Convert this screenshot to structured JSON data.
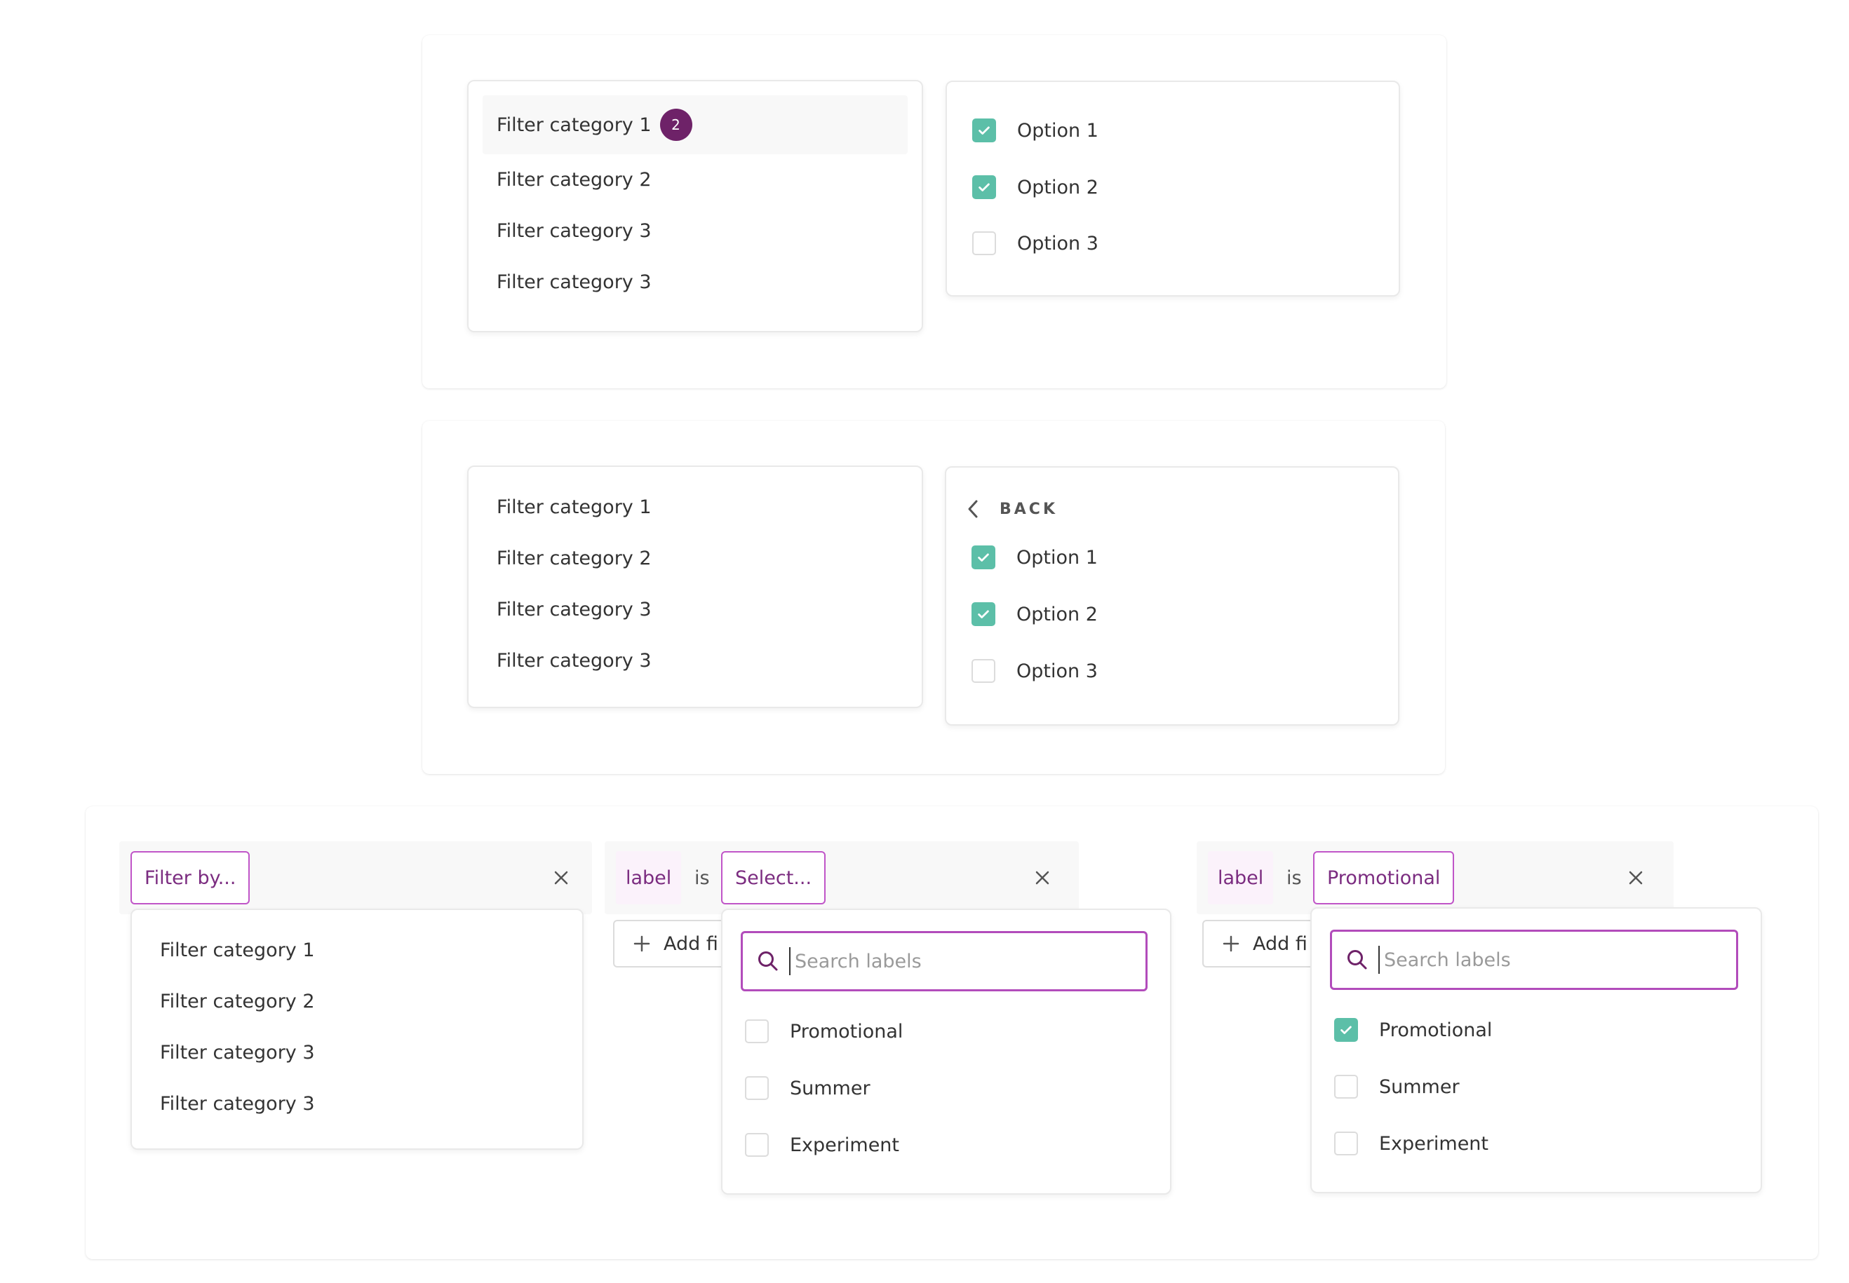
{
  "panel1": {
    "categories": [
      {
        "label": "Filter category 1",
        "badge": "2"
      },
      {
        "label": "Filter category 2"
      },
      {
        "label": "Filter category 3"
      },
      {
        "label": "Filter category 3"
      }
    ],
    "options": [
      {
        "label": "Option 1",
        "checked": true
      },
      {
        "label": "Option 2",
        "checked": true
      },
      {
        "label": "Option 3",
        "checked": false
      }
    ]
  },
  "panel2": {
    "categories": [
      "Filter category 1",
      "Filter category 2",
      "Filter category 3",
      "Filter category 3"
    ],
    "back_label": "BACK",
    "options": [
      {
        "label": "Option 1",
        "checked": true
      },
      {
        "label": "Option 2",
        "checked": true
      },
      {
        "label": "Option 3",
        "checked": false
      }
    ]
  },
  "panel3": {
    "filter1": {
      "pill": "Filter by...",
      "menu": [
        "Filter category 1",
        "Filter category 2",
        "Filter category 3",
        "Filter category 3"
      ]
    },
    "filter2": {
      "label_tag": "label",
      "is_word": "is",
      "pill": "Select...",
      "add_label": "Add fi",
      "search_placeholder": "Search labels",
      "options": [
        {
          "label": "Promotional",
          "checked": false
        },
        {
          "label": "Summer",
          "checked": false
        },
        {
          "label": "Experiment",
          "checked": false
        }
      ]
    },
    "filter3": {
      "label_tag": "label",
      "is_word": "is",
      "pill": "Promotional",
      "add_label": "Add fi",
      "search_placeholder": "Search labels",
      "options": [
        {
          "label": "Promotional",
          "checked": true
        },
        {
          "label": "Summer",
          "checked": false
        },
        {
          "label": "Experiment",
          "checked": false
        }
      ]
    }
  },
  "colors": {
    "accent_purple": "#b24cbb",
    "badge_purple": "#6e2268",
    "check_green": "#5cbfa8"
  }
}
